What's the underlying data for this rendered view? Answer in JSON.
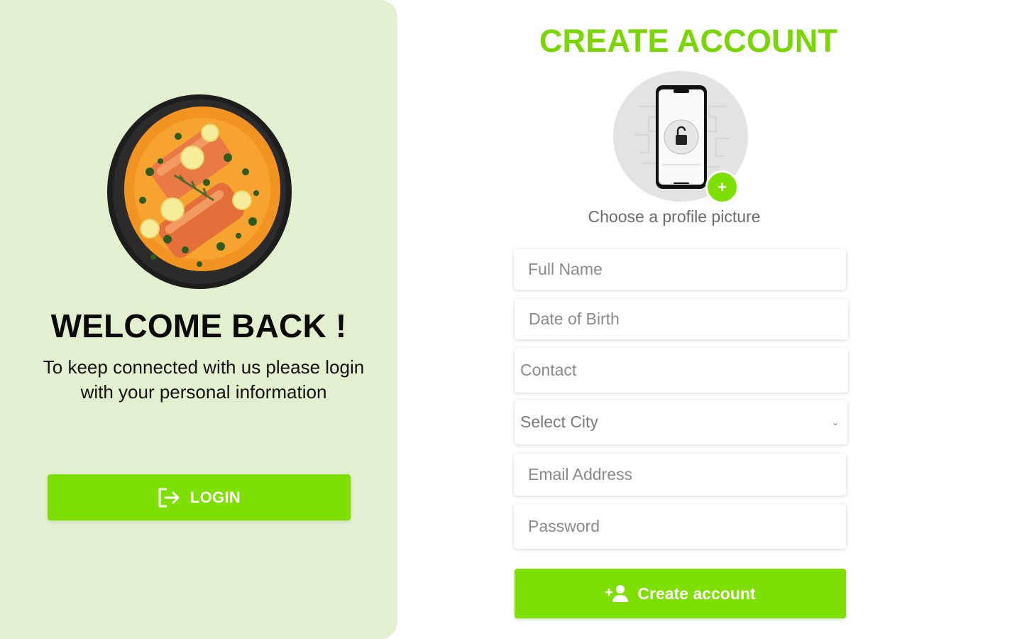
{
  "colors": {
    "accent": "#7ee000",
    "panel_bg": "#e2f0d0",
    "title_green": "#79d600"
  },
  "welcome": {
    "title": "WELCOME BACK !",
    "subtitle_line1": "To keep connected with us please login",
    "subtitle_line2": "with your personal information",
    "login_label": "LOGIN",
    "login_icon": "login-icon",
    "image_icon": "salmon-dish-image"
  },
  "signup": {
    "title": "CREATE ACCOUNT",
    "avatar_icon": "phone-lock-image",
    "add_photo_symbol": "+",
    "choose_picture_label": "Choose a profile picture",
    "fields": {
      "full_name_placeholder": "Full Name",
      "dob_placeholder": "Date of Birth",
      "contact_placeholder": "Contact",
      "city_selected": "Select City",
      "email_placeholder": "Email Address",
      "password_placeholder": "Password"
    },
    "create_label": "Create account",
    "create_icon": "add-user-icon"
  }
}
